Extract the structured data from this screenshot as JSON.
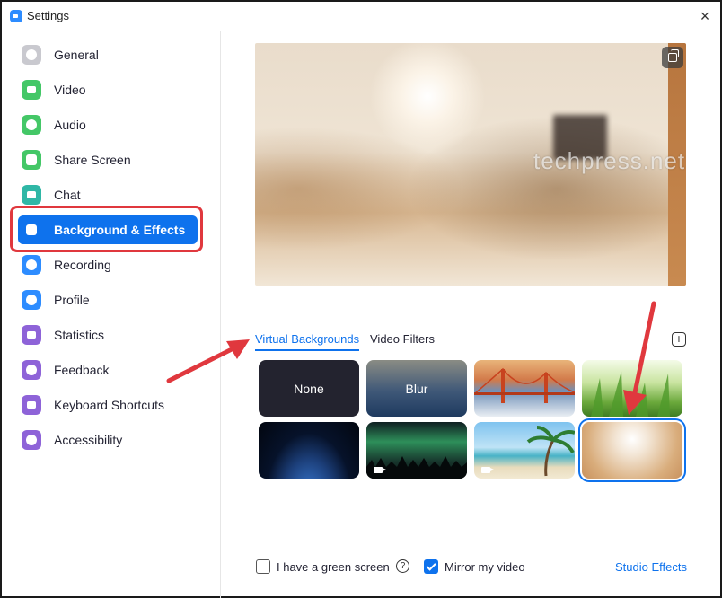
{
  "window": {
    "title": "Settings",
    "close_glyph": "×"
  },
  "sidebar": {
    "items": [
      {
        "label": "General",
        "icon": "gear-icon",
        "color": "#9b9ba5"
      },
      {
        "label": "Video",
        "icon": "video-camera-icon",
        "color": "#44c767"
      },
      {
        "label": "Audio",
        "icon": "headphones-icon",
        "color": "#44c767"
      },
      {
        "label": "Share Screen",
        "icon": "share-screen-icon",
        "color": "#44c767"
      },
      {
        "label": "Chat",
        "icon": "chat-bubble-icon",
        "color": "#2fb7a6"
      },
      {
        "label": "Background & Effects",
        "icon": "background-icon",
        "color": "#0e72ed",
        "active": true
      },
      {
        "label": "Recording",
        "icon": "record-icon",
        "color": "#2d8cff"
      },
      {
        "label": "Profile",
        "icon": "profile-icon",
        "color": "#2d8cff"
      },
      {
        "label": "Statistics",
        "icon": "statistics-icon",
        "color": "#8e63d8"
      },
      {
        "label": "Feedback",
        "icon": "feedback-smiley-icon",
        "color": "#8e63d8"
      },
      {
        "label": "Keyboard Shortcuts",
        "icon": "keyboard-icon",
        "color": "#8e63d8"
      },
      {
        "label": "Accessibility",
        "icon": "accessibility-icon",
        "color": "#8e63d8"
      }
    ]
  },
  "preview": {
    "watermark": "techpress.net"
  },
  "tabs": {
    "virtual_backgrounds": "Virtual Backgrounds",
    "video_filters": "Video Filters",
    "add_glyph": "+"
  },
  "backgrounds": [
    {
      "label": "None",
      "name": "none"
    },
    {
      "label": "Blur",
      "name": "blur"
    },
    {
      "label": "",
      "name": "golden-gate-bridge"
    },
    {
      "label": "",
      "name": "grass"
    },
    {
      "label": "",
      "name": "earth-from-space"
    },
    {
      "label": "",
      "name": "aurora-video"
    },
    {
      "label": "",
      "name": "beach-video"
    },
    {
      "label": "",
      "name": "living-room",
      "selected": true
    }
  ],
  "footer": {
    "green_screen_label": "I have a green screen",
    "green_screen_checked": false,
    "help_glyph": "?",
    "mirror_label": "Mirror my video",
    "mirror_checked": true,
    "studio_effects": "Studio Effects"
  },
  "colors": {
    "accent": "#0e72ed",
    "highlight_red": "#e0383e"
  }
}
